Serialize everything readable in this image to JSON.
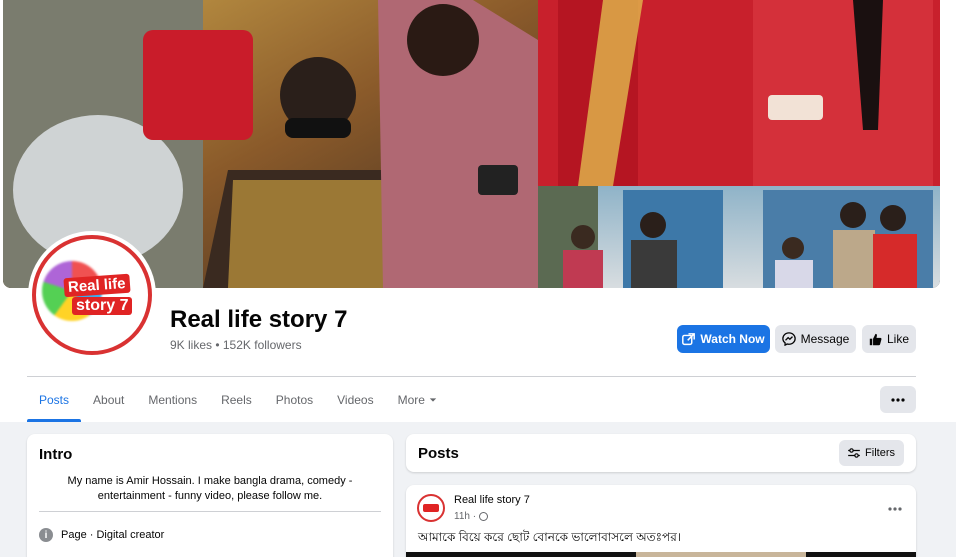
{
  "profile": {
    "name": "Real life story 7",
    "stats": "9K likes • 152K followers",
    "logo_line1": "Real life",
    "logo_line2": "story 7"
  },
  "actions": {
    "watch_label": "Watch Now",
    "message_label": "Message",
    "like_label": "Like"
  },
  "tabs": [
    {
      "label": "Posts",
      "active": true
    },
    {
      "label": "About"
    },
    {
      "label": "Mentions"
    },
    {
      "label": "Reels"
    },
    {
      "label": "Photos"
    },
    {
      "label": "Videos"
    },
    {
      "label": "More"
    }
  ],
  "intro": {
    "title": "Intro",
    "bio": "My name is Amir Hossain. I make bangla drama, comedy - entertainment - funny video, please follow me.",
    "category": "Page · Digital creator"
  },
  "posts_section": {
    "title": "Posts",
    "filters_label": "Filters"
  },
  "post": {
    "author": "Real life story 7",
    "time": "11h ·",
    "text": "আমাকে বিয়ে করে ছোট বোনকে ভালোবাসলে অতঃপর।"
  },
  "colors": {
    "accent": "#1b74e4",
    "brand_red": "#e02424",
    "background": "#f0f2f5"
  },
  "icons": {
    "watch": "external-link-icon",
    "message": "messenger-icon",
    "like": "thumbs-up-icon",
    "filters": "sliders-icon",
    "info": "info-icon"
  }
}
